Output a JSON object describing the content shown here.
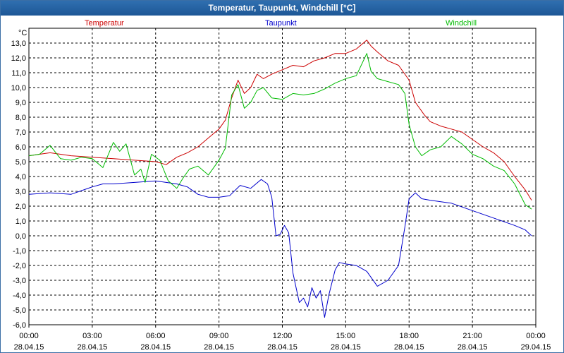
{
  "window": {
    "title": "Temperatur, Taupunkt, Windchill [°C]"
  },
  "chart_data": {
    "type": "line",
    "title": "Temperatur, Taupunkt, Windchill [°C]",
    "ylabel": "°C",
    "ylim": [
      -6.0,
      14.0
    ],
    "xlim": [
      0,
      24
    ],
    "yticks": [
      "13,0",
      "12,0",
      "11,0",
      "10,0",
      "9,0",
      "8,0",
      "7,0",
      "6,0",
      "5,0",
      "4,0",
      "3,0",
      "2,0",
      "1,0",
      "0,0",
      "-1,0",
      "-2,0",
      "-3,0",
      "-4,0",
      "-5,0",
      "-6,0"
    ],
    "xticks": [
      {
        "time": "00:00",
        "date": "28.04.15"
      },
      {
        "time": "03:00",
        "date": "28.04.15"
      },
      {
        "time": "06:00",
        "date": "28.04.15"
      },
      {
        "time": "09:00",
        "date": "28.04.15"
      },
      {
        "time": "12:00",
        "date": "28.04.15"
      },
      {
        "time": "15:00",
        "date": "28.04.15"
      },
      {
        "time": "18:00",
        "date": "28.04.15"
      },
      {
        "time": "21:00",
        "date": "28.04.15"
      },
      {
        "time": "00:00",
        "date": "29.04.15"
      }
    ],
    "grid": true,
    "legend_placement": "top",
    "series": [
      {
        "name": "Temperatur",
        "color": "#cc0000",
        "x": [
          0,
          1,
          2,
          3,
          4,
          5,
          6,
          6.5,
          7,
          7.5,
          8,
          8.5,
          9,
          9.3,
          9.6,
          9.9,
          10.2,
          10.5,
          10.8,
          11.1,
          11.5,
          12,
          12.5,
          13,
          13.5,
          14,
          14.5,
          15,
          15.5,
          16,
          16.2,
          16.5,
          17,
          17.5,
          18,
          18.3,
          18.7,
          19,
          19.5,
          20,
          20.5,
          21,
          21.5,
          22,
          22.5,
          23,
          23.5,
          23.8
        ],
        "y": [
          5.4,
          5.6,
          5.4,
          5.3,
          5.2,
          5.1,
          5.0,
          4.8,
          5.3,
          5.6,
          6.0,
          6.6,
          7.2,
          7.8,
          9.3,
          10.5,
          9.6,
          10.0,
          10.9,
          10.6,
          10.9,
          11.2,
          11.5,
          11.4,
          11.8,
          12.0,
          12.3,
          12.3,
          12.6,
          13.2,
          12.8,
          12.4,
          11.8,
          11.5,
          10.5,
          9.0,
          8.2,
          7.7,
          7.4,
          7.2,
          7.0,
          6.5,
          6.0,
          5.6,
          5.0,
          4.0,
          3.1,
          2.4
        ]
      },
      {
        "name": "Taupunkt",
        "color": "#0000cc",
        "x": [
          0,
          1,
          2,
          3,
          3.5,
          4,
          5,
          6,
          7,
          7.5,
          8,
          8.5,
          9,
          9.5,
          10,
          10.5,
          11,
          11.3,
          11.5,
          11.7,
          11.9,
          12.1,
          12.3,
          12.5,
          12.8,
          13,
          13.2,
          13.4,
          13.6,
          13.8,
          14,
          14.2,
          14.5,
          14.7,
          15,
          15.5,
          16,
          16.5,
          17,
          17.5,
          17.8,
          18,
          18.3,
          18.6,
          19,
          20,
          21,
          22,
          23,
          23.5,
          23.8
        ],
        "y": [
          2.8,
          2.9,
          2.8,
          3.3,
          3.5,
          3.5,
          3.6,
          3.7,
          3.5,
          3.3,
          2.8,
          2.6,
          2.6,
          2.7,
          3.4,
          3.2,
          3.8,
          3.5,
          2.6,
          0.0,
          0.1,
          0.7,
          0.2,
          -2.5,
          -4.5,
          -4.2,
          -4.8,
          -3.5,
          -4.2,
          -3.7,
          -5.5,
          -4.0,
          -2.3,
          -1.8,
          -1.9,
          -2.0,
          -2.4,
          -3.4,
          -3.0,
          -2.0,
          0.6,
          2.5,
          2.9,
          2.5,
          2.4,
          2.2,
          1.7,
          1.2,
          0.7,
          0.4,
          0.0
        ]
      },
      {
        "name": "Windchill",
        "color": "#00bb00",
        "x": [
          0,
          0.5,
          1,
          1.5,
          2,
          2.5,
          3,
          3.5,
          4,
          4.3,
          4.6,
          5,
          5.3,
          5.5,
          5.8,
          6.2,
          6.6,
          7,
          7.3,
          7.6,
          8,
          8.5,
          9,
          9.3,
          9.6,
          9.9,
          10.2,
          10.5,
          10.8,
          11.1,
          11.5,
          12,
          12.5,
          13,
          13.5,
          14,
          14.5,
          15,
          15.5,
          16,
          16.2,
          16.5,
          17,
          17.5,
          17.8,
          18,
          18.3,
          18.6,
          19,
          19.5,
          20,
          20.5,
          21,
          21.5,
          22,
          22.5,
          23,
          23.5,
          23.8
        ],
        "y": [
          5.4,
          5.5,
          6.1,
          5.2,
          5.1,
          5.3,
          5.2,
          4.6,
          6.3,
          5.7,
          6.2,
          4.1,
          4.5,
          3.6,
          5.5,
          5.1,
          3.7,
          3.2,
          3.9,
          4.5,
          4.7,
          4.1,
          5.1,
          5.9,
          9.5,
          10.2,
          8.6,
          9.0,
          9.8,
          10.0,
          9.3,
          9.2,
          9.6,
          9.5,
          9.6,
          9.9,
          10.3,
          10.6,
          10.8,
          12.3,
          11.1,
          10.6,
          10.4,
          10.2,
          9.6,
          7.5,
          6.0,
          5.4,
          5.8,
          6.0,
          6.7,
          6.2,
          5.5,
          5.2,
          4.7,
          4.4,
          3.5,
          2.1,
          1.8
        ]
      }
    ]
  }
}
